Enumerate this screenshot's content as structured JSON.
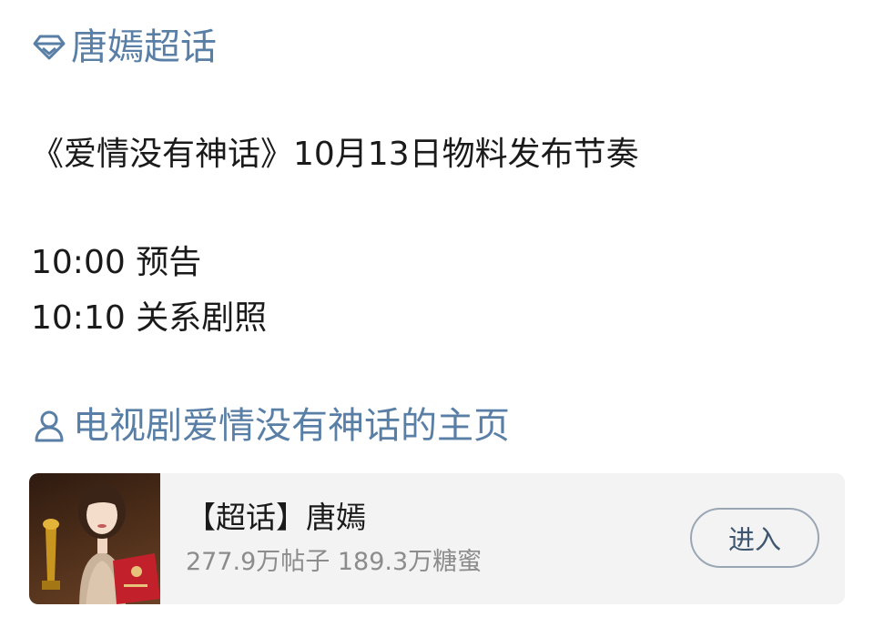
{
  "topic": {
    "label": "唐嫣超话",
    "icon": "diamond-icon"
  },
  "post": {
    "lines": [
      "《爱情没有神话》10月13日物料发布节奏",
      "10:00 预告",
      "10:10 关系剧照"
    ]
  },
  "profile_link": {
    "label": "电视剧爱情没有神话的主页",
    "icon": "person-icon"
  },
  "card": {
    "title": "【超话】唐嫣",
    "stats": "277.9万帖子 189.3万糖蜜",
    "button_label": "进入",
    "thumbnail": "avatar-photo"
  },
  "colors": {
    "link": "#5a7fa6",
    "text": "#1a1a1a",
    "muted": "#8c8c8c",
    "card_bg": "#f3f3f3",
    "button_border": "#9aa6b4"
  }
}
